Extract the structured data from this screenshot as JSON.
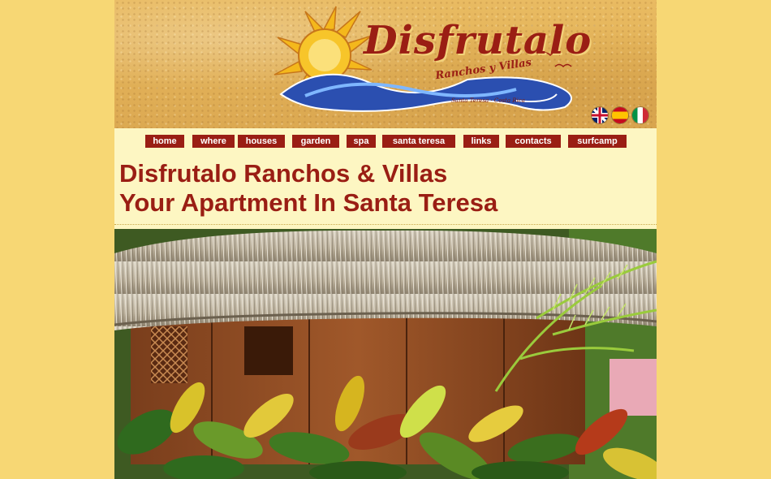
{
  "logo": {
    "title": "Disfrutalo",
    "subtitle": "Ranchos y Villas",
    "location": "Santa Teresa · Costa Rica"
  },
  "languages": [
    {
      "name": "English",
      "icon": "uk-flag-icon"
    },
    {
      "name": "Español",
      "icon": "spain-flag-icon"
    },
    {
      "name": "Italiano",
      "icon": "italy-flag-icon"
    }
  ],
  "nav": {
    "items": [
      {
        "label": "home"
      },
      {
        "label": "where"
      },
      {
        "label": "houses"
      },
      {
        "label": "garden"
      },
      {
        "label": "spa"
      },
      {
        "label": "santa teresa"
      },
      {
        "label": "links"
      },
      {
        "label": "contacts"
      },
      {
        "label": "surfcamp"
      }
    ]
  },
  "heading": {
    "line1": "Disfrutalo Ranchos & Villas",
    "line2": "Your Apartment In Santa Teresa"
  },
  "colors": {
    "background": "#f7d774",
    "content_bg": "#fdf6c2",
    "accent": "#9a1e14"
  },
  "photo": {
    "icon": "thatched-hut-garden-photo"
  }
}
